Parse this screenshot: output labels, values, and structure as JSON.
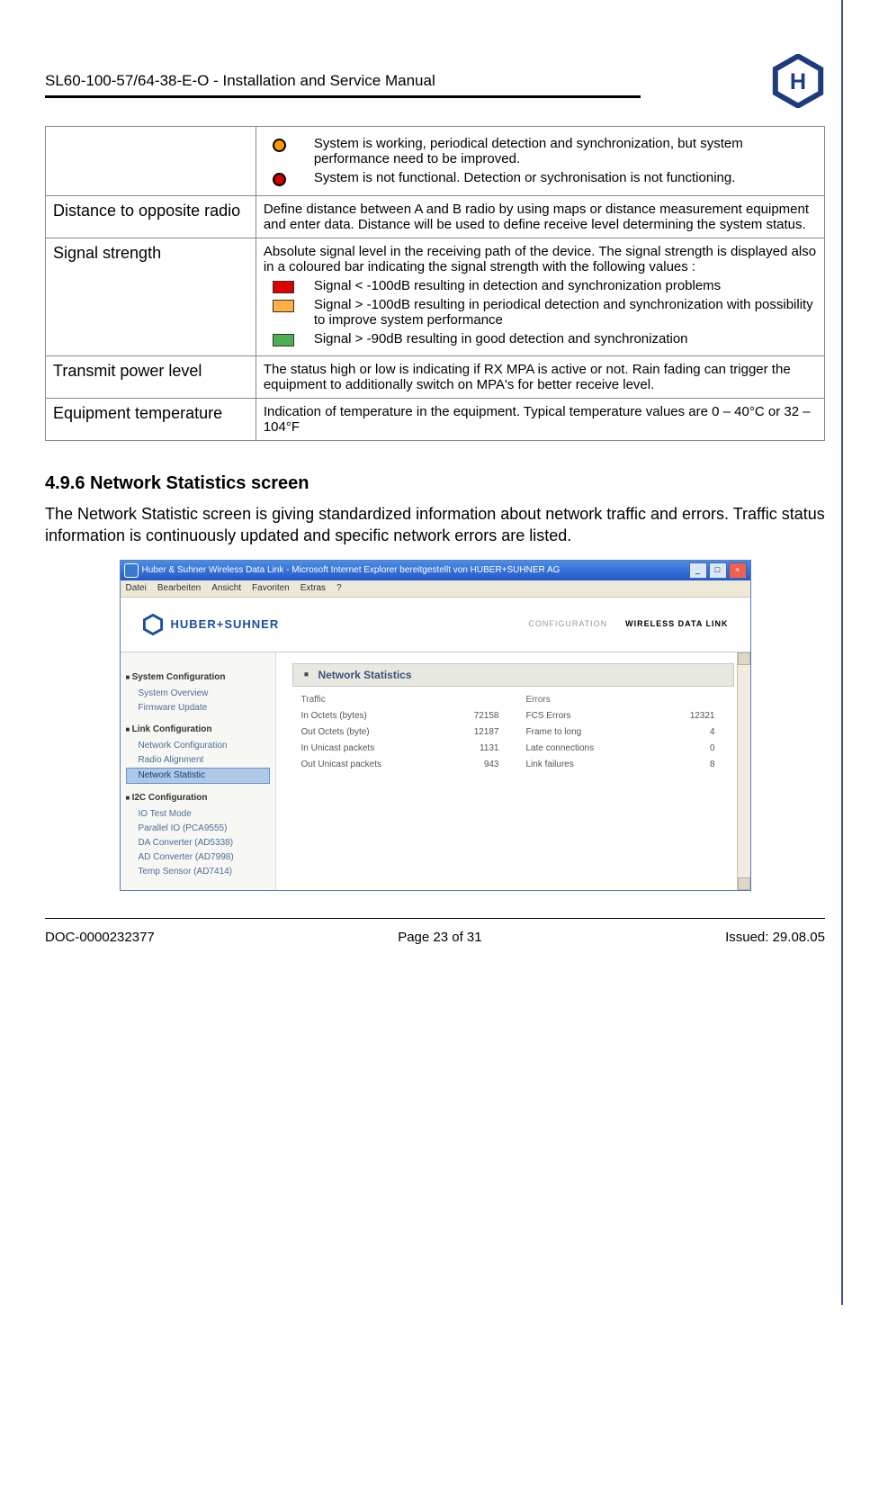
{
  "header": {
    "title": "SL60-100-57/64-38-E-O  -  Installation and Service Manual"
  },
  "top_statuses": [
    {
      "color": "orange",
      "text": "System is working, periodical detection and synchronization, but system performance need to be improved."
    },
    {
      "color": "red-dot",
      "text": "System is not functional. Detection or sychronisation is not functioning."
    }
  ],
  "rows": [
    {
      "label": "Distance to opposite radio",
      "text": "Define distance between A and B radio by using maps or distance measurement equipment and enter data. Distance will be used to define receive level determining the system status."
    }
  ],
  "signal": {
    "label": "Signal strength",
    "intro": "Absolute signal level in the receiving path of the device. The signal strength is displayed also in a coloured bar indicating the signal strength with the following values :",
    "items": [
      {
        "color": "red",
        "text": "Signal < -100dB resulting in detection and synchronization problems"
      },
      {
        "color": "orange",
        "text": "Signal > -100dB resulting in periodical detection and synchronization with possibility to improve system performance"
      },
      {
        "color": "green",
        "text": "Signal > -90dB resulting in good detection and synchronization"
      }
    ]
  },
  "transmit": {
    "label": "Transmit power level",
    "text": "The status high or low is indicating if RX MPA is active or not. Rain fading can trigger the equipment to additionally switch on MPA's for better receive level."
  },
  "equipment": {
    "label": "Equipment temperature",
    "text": "Indication of temperature in the equipment. Typical temperature values are 0 – 40°C or  32 – 104°F"
  },
  "section": {
    "heading": "4.9.6  Network Statistics screen",
    "paragraph": "The Network Statistic screen is giving standardized information about network traffic and errors. Traffic status information is continuously updated and specific network errors are listed."
  },
  "screenshot": {
    "titlebar": "Huber & Suhner Wireless Data Link - Microsoft Internet Explorer bereitgestellt von HUBER+SUHNER AG",
    "menus": [
      "Datei",
      "Bearbeiten",
      "Ansicht",
      "Favoriten",
      "Extras",
      "?"
    ],
    "brand": "HUBER+SUHNER",
    "brandTabs": {
      "config": "CONFIGURATION",
      "wdl": "WIRELESS DATA LINK"
    },
    "sidebar": {
      "sections": [
        {
          "title": "System Configuration",
          "items": [
            "System Overview",
            "Firmware Update"
          ]
        },
        {
          "title": "Link Configuration",
          "items": [
            "Network Configuration",
            "Radio Alignment",
            "Network Statistic"
          ],
          "selected": 2
        },
        {
          "title": "I2C Configuration",
          "items": [
            "IO Test Mode",
            "Parallel IO (PCA9555)",
            "DA Converter (AD5338)",
            "AD Converter (AD7998)",
            "Temp Sensor (AD7414)"
          ]
        }
      ]
    },
    "content": {
      "heading": "Network Statistics",
      "headers": {
        "h1": "Traffic",
        "h2": "Errors"
      },
      "rows": [
        {
          "a": "In Octets (bytes)",
          "av": "72158",
          "b": "FCS Errors",
          "bv": "12321"
        },
        {
          "a": "Out Octets (byte)",
          "av": "12187",
          "b": "Frame to long",
          "bv": "4"
        },
        {
          "a": "In Unicast packets",
          "av": "1131",
          "b": "Late connections",
          "bv": "0"
        },
        {
          "a": "Out Unicast packets",
          "av": "943",
          "b": "Link failures",
          "bv": "8"
        }
      ]
    }
  },
  "footer": {
    "left": "DOC-0000232377",
    "center": "Page 23 of 31",
    "right": "Issued: 29.08.05"
  }
}
